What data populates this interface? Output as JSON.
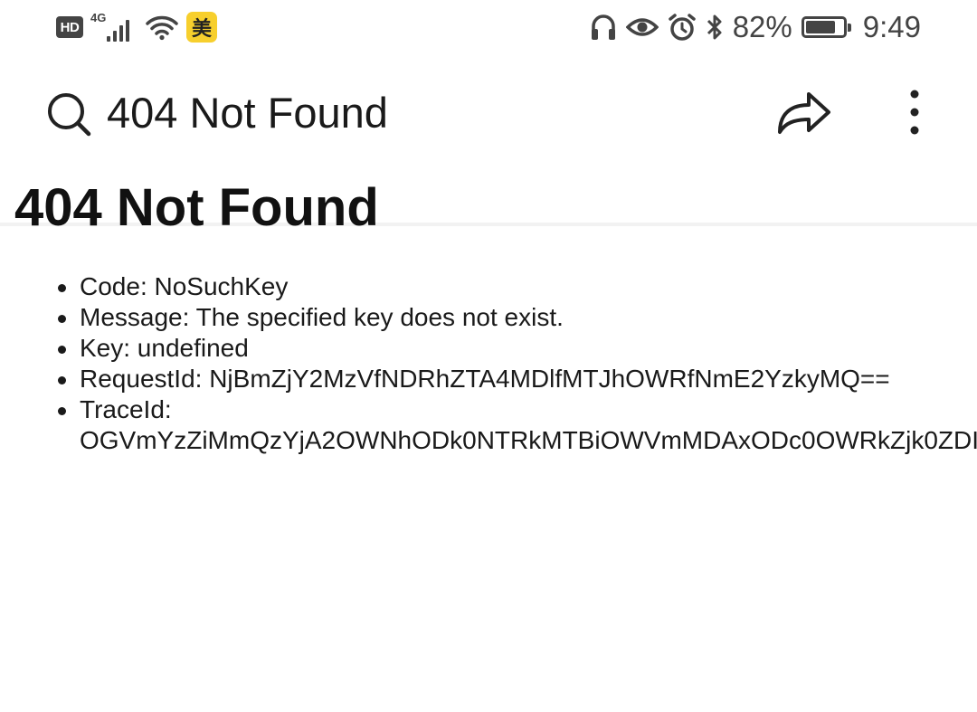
{
  "status_bar": {
    "hd_label": "HD",
    "network_label": "4G",
    "app_icon_label": "美",
    "battery_percent": "82%",
    "battery_level": 0.82,
    "time": "9:49",
    "icons": [
      "hd-icon",
      "signal-icon",
      "wifi-icon",
      "meituan-app-icon",
      "headphones-icon",
      "eye-icon",
      "alarm-icon",
      "bluetooth-icon",
      "battery-icon"
    ]
  },
  "toolbar": {
    "title": "404 Not Found",
    "icons": [
      "search-icon",
      "share-icon",
      "more-icon"
    ]
  },
  "page": {
    "heading": "404 Not Found",
    "details": [
      {
        "text": "Code: NoSuchKey"
      },
      {
        "text": "Message: The specified key does not exist."
      },
      {
        "text": "Key: undefined"
      },
      {
        "text": "RequestId: NjBmZjY2MzVfNDRhZTA4MDlfMTJhOWRfNmE2YzkyMQ=="
      }
    ],
    "trace_label": "TraceId:",
    "trace_value": "OGVmYzZiMmQzYjA2OWNhODk0NTRkMTBiOWVmMDAxODc0OWRkZjk0ZDI"
  },
  "colors": {
    "icon": "#444444",
    "text": "#1a1a1a",
    "app_icon_bg": "#f7cf2d"
  }
}
